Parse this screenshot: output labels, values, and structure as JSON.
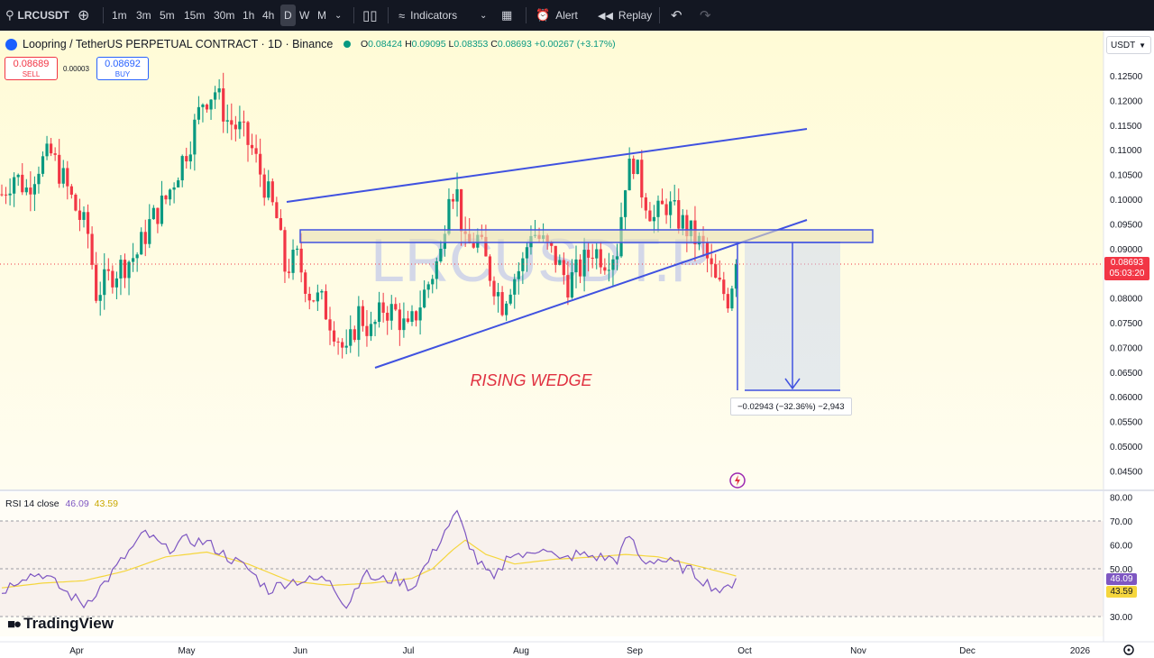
{
  "toolbar": {
    "symbol": "LRCUSDT",
    "intervals": [
      "1m",
      "3m",
      "5m",
      "15m",
      "30m",
      "1h",
      "4h",
      "D",
      "W",
      "M"
    ],
    "active_interval": "D",
    "indicators_label": "Indicators",
    "alert_label": "Alert",
    "replay_label": "Replay"
  },
  "legend": {
    "title": "Loopring / TetherUS PERPETUAL CONTRACT · 1D · Binance",
    "o_label": "O",
    "o": "0.08424",
    "h_label": "H",
    "h": "0.09095",
    "l_label": "L",
    "l": "0.08353",
    "c_label": "C",
    "c": "0.08693",
    "change": "+0.00267 (+3.17%)"
  },
  "trade": {
    "sell_price": "0.08689",
    "sell_label": "SELL",
    "spread": "0.00003",
    "buy_price": "0.08692",
    "buy_label": "BUY"
  },
  "currency": "USDT",
  "watermark": "LRCUSDT.P",
  "annotation": "RISING WEDGE",
  "measure": "−0.02943 (−32.36%) −2,943",
  "price_tag": {
    "price": "0.08693",
    "countdown": "05:03:20"
  },
  "rsi": {
    "label": "RSI 14 close",
    "value": "46.09",
    "ma": "43.59"
  },
  "logo": "TradingView",
  "colors": {
    "up": "#089981",
    "down": "#f23645",
    "line": "#4052e0",
    "rsi": "#7e57c2",
    "rsi_ma": "#f5d63d",
    "label_red": "#e03040"
  },
  "chart_data": {
    "type": "candlestick",
    "y_ticks": [
      "0.12500",
      "0.12000",
      "0.11500",
      "0.11000",
      "0.10500",
      "0.10000",
      "0.09500",
      "0.09000",
      "0.08500",
      "0.08000",
      "0.07500",
      "0.07000",
      "0.06500",
      "0.06000",
      "0.05500",
      "0.05000",
      "0.04500"
    ],
    "x_ticks": [
      "Apr",
      "May",
      "Jun",
      "Jul",
      "Aug",
      "Sep",
      "Oct",
      "Nov",
      "Dec",
      "2026"
    ],
    "rsi_ticks": [
      "80.00",
      "70.00",
      "60.00",
      "50.00",
      "30.00"
    ],
    "ylim": [
      0.042,
      0.128
    ],
    "close_path": [
      [
        0,
        0.101
      ],
      [
        3,
        0.105
      ],
      [
        6,
        0.102
      ],
      [
        9,
        0.107
      ],
      [
        12,
        0.109
      ],
      [
        15,
        0.104
      ],
      [
        18,
        0.098
      ],
      [
        21,
        0.093
      ],
      [
        23,
        0.081
      ],
      [
        25,
        0.083
      ],
      [
        27,
        0.085
      ],
      [
        30,
        0.087
      ],
      [
        33,
        0.089
      ],
      [
        36,
        0.095
      ],
      [
        40,
        0.1
      ],
      [
        43,
        0.106
      ],
      [
        46,
        0.112
      ],
      [
        49,
        0.12
      ],
      [
        52,
        0.122
      ],
      [
        55,
        0.116
      ],
      [
        58,
        0.114
      ],
      [
        61,
        0.11
      ],
      [
        64,
        0.103
      ],
      [
        67,
        0.096
      ],
      [
        69,
        0.086
      ],
      [
        72,
        0.088
      ],
      [
        75,
        0.081
      ],
      [
        78,
        0.079
      ],
      [
        81,
        0.074
      ],
      [
        84,
        0.068
      ],
      [
        87,
        0.077
      ],
      [
        90,
        0.073
      ],
      [
        93,
        0.078
      ],
      [
        96,
        0.077
      ],
      [
        99,
        0.073
      ],
      [
        102,
        0.079
      ],
      [
        105,
        0.085
      ],
      [
        107,
        0.089
      ],
      [
        109,
        0.103
      ],
      [
        111,
        0.101
      ],
      [
        113,
        0.09
      ],
      [
        116,
        0.092
      ],
      [
        119,
        0.085
      ],
      [
        122,
        0.079
      ],
      [
        124,
        0.083
      ],
      [
        127,
        0.087
      ],
      [
        129,
        0.094
      ],
      [
        132,
        0.091
      ],
      [
        135,
        0.088
      ],
      [
        138,
        0.083
      ],
      [
        141,
        0.086
      ],
      [
        144,
        0.09
      ],
      [
        147,
        0.088
      ],
      [
        150,
        0.09
      ],
      [
        152,
        0.104
      ],
      [
        154,
        0.108
      ],
      [
        156,
        0.102
      ],
      [
        159,
        0.096
      ],
      [
        162,
        0.099
      ],
      [
        165,
        0.096
      ],
      [
        168,
        0.093
      ],
      [
        171,
        0.09
      ],
      [
        174,
        0.083
      ],
      [
        177,
        0.08
      ],
      [
        179,
        0.0869
      ]
    ],
    "rsi_path": [
      [
        0,
        40.5
      ],
      [
        5,
        47
      ],
      [
        10,
        48
      ],
      [
        15,
        41
      ],
      [
        20,
        35
      ],
      [
        25,
        44
      ],
      [
        30,
        55
      ],
      [
        35,
        65
      ],
      [
        40,
        58
      ],
      [
        45,
        62
      ],
      [
        50,
        61
      ],
      [
        55,
        55
      ],
      [
        60,
        50
      ],
      [
        65,
        41
      ],
      [
        70,
        45
      ],
      [
        75,
        45
      ],
      [
        80,
        46
      ],
      [
        84,
        34
      ],
      [
        88,
        48
      ],
      [
        92,
        45
      ],
      [
        96,
        46
      ],
      [
        100,
        42
      ],
      [
        105,
        56
      ],
      [
        108,
        66
      ],
      [
        111,
        73
      ],
      [
        113,
        64
      ],
      [
        116,
        53
      ],
      [
        120,
        45
      ],
      [
        124,
        57
      ],
      [
        128,
        55
      ],
      [
        132,
        60
      ],
      [
        136,
        53
      ],
      [
        140,
        56
      ],
      [
        145,
        55
      ],
      [
        150,
        54
      ],
      [
        153,
        64
      ],
      [
        156,
        53
      ],
      [
        160,
        54
      ],
      [
        164,
        52
      ],
      [
        168,
        49
      ],
      [
        172,
        44
      ],
      [
        176,
        40
      ],
      [
        179,
        46
      ]
    ],
    "rsi_ma_path": [
      [
        0,
        42
      ],
      [
        10,
        44
      ],
      [
        20,
        45
      ],
      [
        30,
        49
      ],
      [
        40,
        55
      ],
      [
        50,
        57
      ],
      [
        60,
        52
      ],
      [
        70,
        45
      ],
      [
        80,
        43
      ],
      [
        90,
        44
      ],
      [
        100,
        46
      ],
      [
        105,
        50
      ],
      [
        110,
        58
      ],
      [
        113,
        62
      ],
      [
        118,
        56
      ],
      [
        125,
        52
      ],
      [
        135,
        54
      ],
      [
        145,
        55
      ],
      [
        152,
        56
      ],
      [
        160,
        55
      ],
      [
        170,
        51
      ],
      [
        179,
        47
      ]
    ]
  }
}
